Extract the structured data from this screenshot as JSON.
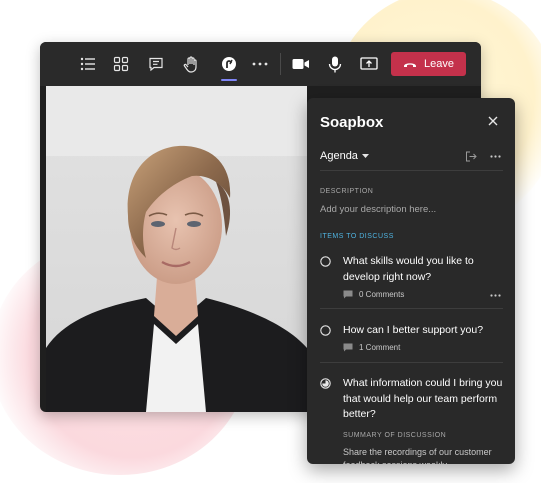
{
  "toolbar": {
    "icons": [
      "participants-list-icon",
      "breakout-rooms-icon",
      "chat-icon",
      "raise-hand-icon",
      "soapbox-app-icon",
      "more-actions-icon",
      "camera-icon",
      "microphone-icon",
      "share-screen-icon"
    ],
    "leave_label": "Leave",
    "leave_color": "#c4314b",
    "active_indicator_color": "#7f85f5"
  },
  "panel": {
    "title": "Soapbox",
    "agenda_label": "Agenda",
    "description_label": "DESCRIPTION",
    "description_placeholder": "Add your description here...",
    "items_label": "ITEMS TO DISCUSS",
    "items_label_color": "#4fb3e0",
    "items": [
      {
        "text": "What skills would you like to develop right now?",
        "comments": "0 Comments",
        "status": "open"
      },
      {
        "text": "How can I better support you?",
        "comments": "1 Comment",
        "status": "open"
      },
      {
        "text": "What information could I bring you that would help our team perform better?",
        "status": "in-progress"
      }
    ],
    "summary_label": "SUMMARY OF DISCUSSION",
    "summary_text": "Share the recordings of our customer feedback sessions weekly"
  }
}
